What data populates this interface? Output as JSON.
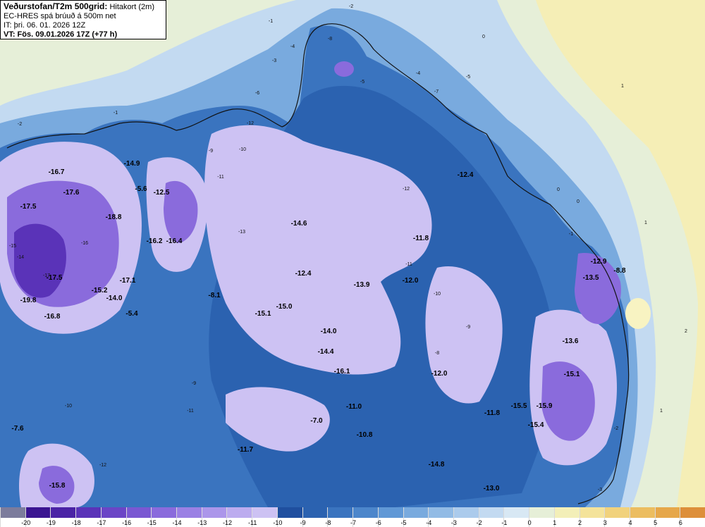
{
  "header": {
    "title": "Veðurstofan/T2m 500grid:",
    "title_sub": "Hitakort (2m)",
    "model": "EC-HRES spá brúuð á 500m net",
    "issue_time": "IT: þri. 06. 01. 2026 12Z",
    "valid_time": "VT: Fös. 09.01.2026 17Z (+77 h)"
  },
  "legend": {
    "cells": [
      {
        "label": "",
        "color": "#7c7c9c"
      },
      {
        "label": "-20",
        "color": "#3a1591"
      },
      {
        "label": "-19",
        "color": "#4a23a5"
      },
      {
        "label": "-18",
        "color": "#5a33b8"
      },
      {
        "label": "-17",
        "color": "#6b45c6"
      },
      {
        "label": "-16",
        "color": "#7a58d2"
      },
      {
        "label": "-15",
        "color": "#8a6bdc"
      },
      {
        "label": "-14",
        "color": "#9a80e4"
      },
      {
        "label": "-13",
        "color": "#ab96ea"
      },
      {
        "label": "-12",
        "color": "#bcacef"
      },
      {
        "label": "-11",
        "color": "#cdc2f3"
      },
      {
        "label": "-10",
        "color": "#1f4f9f"
      },
      {
        "label": "-9",
        "color": "#2b62b0"
      },
      {
        "label": "-8",
        "color": "#3a74bf"
      },
      {
        "label": "-7",
        "color": "#4c86cb"
      },
      {
        "label": "-6",
        "color": "#6098d6"
      },
      {
        "label": "-5",
        "color": "#79aade"
      },
      {
        "label": "-4",
        "color": "#92bbe5"
      },
      {
        "label": "-3",
        "color": "#abcbec"
      },
      {
        "label": "-2",
        "color": "#c3daf1"
      },
      {
        "label": "-1",
        "color": "#d8e8f4"
      },
      {
        "label": "0",
        "color": "#e6efd8"
      },
      {
        "label": "1",
        "color": "#f3efb8"
      },
      {
        "label": "2",
        "color": "#f4e39a"
      },
      {
        "label": "3",
        "color": "#f1d27c"
      },
      {
        "label": "4",
        "color": "#ecbd60"
      },
      {
        "label": "5",
        "color": "#e6a74a"
      },
      {
        "label": "6",
        "color": "#dd8f3a"
      }
    ]
  },
  "map": {
    "colors": {
      "sea_far": "#f5eeb6",
      "sea_mid": "#e6efd8",
      "sea_near": "#c3daf1",
      "coast": "#79aade",
      "land_base": "#3a74bf",
      "land_cold": "#2b62b0",
      "highland": "#cdc2f3",
      "very_cold": "#8a6bdc",
      "extreme": "#5a33b8",
      "island": "#f8f3c2"
    },
    "temperature_labels": [
      {
        "text": "-16.7"
      },
      {
        "text": "-17.6"
      },
      {
        "text": "-17.5"
      },
      {
        "text": "-18.8"
      },
      {
        "text": "-14.9"
      },
      {
        "text": "-12.5"
      },
      {
        "text": "-5.6"
      },
      {
        "text": "-16.2"
      },
      {
        "text": "-16.4"
      },
      {
        "text": "-17.5"
      },
      {
        "text": "-17.1"
      },
      {
        "text": "-15.2"
      },
      {
        "text": "-14.0"
      },
      {
        "text": "-19.8"
      },
      {
        "text": "-16.8"
      },
      {
        "text": "-5.4"
      },
      {
        "text": "-8.1"
      },
      {
        "text": "-14.6"
      },
      {
        "text": "-12.4"
      },
      {
        "text": "-12.4"
      },
      {
        "text": "-13.9"
      },
      {
        "text": "-12.0"
      },
      {
        "text": "-11.8"
      },
      {
        "text": "-15.1"
      },
      {
        "text": "-15.0"
      },
      {
        "text": "-14.0"
      },
      {
        "text": "-14.4"
      },
      {
        "text": "-16.1"
      },
      {
        "text": "-12.0"
      },
      {
        "text": "-11.0"
      },
      {
        "text": "-7.0"
      },
      {
        "text": "-10.8"
      },
      {
        "text": "-11.7"
      },
      {
        "text": "-7.6"
      },
      {
        "text": "-15.8"
      },
      {
        "text": "-11.8"
      },
      {
        "text": "-15.5"
      },
      {
        "text": "-15.9"
      },
      {
        "text": "-15.4"
      },
      {
        "text": "-14.8"
      },
      {
        "text": "-13.0"
      },
      {
        "text": "-12.9"
      },
      {
        "text": "-8.8"
      },
      {
        "text": "-13.5"
      },
      {
        "text": "-13.6"
      },
      {
        "text": "-15.1"
      }
    ],
    "contour_labels": [
      {
        "text": "-2"
      },
      {
        "text": "-1"
      },
      {
        "text": "0"
      },
      {
        "text": "1"
      },
      {
        "text": "-3"
      },
      {
        "text": "-4"
      },
      {
        "text": "-5"
      },
      {
        "text": "-6"
      },
      {
        "text": "-7"
      },
      {
        "text": "-8"
      },
      {
        "text": "-9"
      },
      {
        "text": "-10"
      },
      {
        "text": "-11"
      },
      {
        "text": "-12"
      },
      {
        "text": "-13"
      },
      {
        "text": "-2"
      },
      {
        "text": "-1"
      },
      {
        "text": "0"
      },
      {
        "text": "1"
      },
      {
        "text": "2"
      },
      {
        "text": "-1"
      },
      {
        "text": "0"
      },
      {
        "text": "1"
      },
      {
        "text": "-3"
      },
      {
        "text": "-2"
      },
      {
        "text": "-5"
      },
      {
        "text": "-4"
      },
      {
        "text": "-9"
      },
      {
        "text": "-10"
      },
      {
        "text": "-11"
      },
      {
        "text": "-12"
      },
      {
        "text": "-14"
      },
      {
        "text": "-15"
      },
      {
        "text": "-16"
      },
      {
        "text": "-17"
      },
      {
        "text": "-12"
      },
      {
        "text": "-11"
      },
      {
        "text": "-10"
      },
      {
        "text": "-9"
      },
      {
        "text": "-8"
      }
    ]
  }
}
